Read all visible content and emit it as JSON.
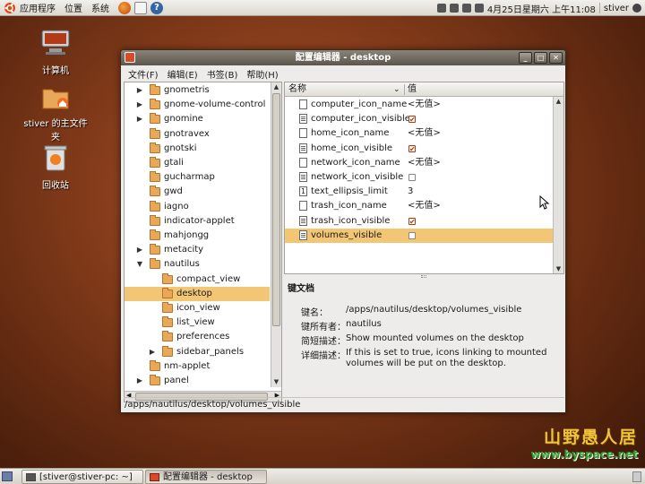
{
  "top_panel": {
    "menus": [
      "应用程序",
      "位置",
      "系统"
    ],
    "clock": "4月25日星期六 上午11:08",
    "user": "stiver"
  },
  "desktop": {
    "icons": [
      {
        "label": "计算机"
      },
      {
        "label": "stiver 的主文件夹"
      },
      {
        "label": "回收站"
      }
    ]
  },
  "window": {
    "title": "配置编辑器 - desktop",
    "menus": [
      "文件(F)",
      "编辑(E)",
      "书签(B)",
      "帮助(H)"
    ],
    "tree": [
      {
        "label": "gnometris",
        "expander": "▶",
        "level": 1
      },
      {
        "label": "gnome-volume-control",
        "expander": "▶",
        "level": 1
      },
      {
        "label": "gnomine",
        "expander": "▶",
        "level": 1
      },
      {
        "label": "gnotravex",
        "expander": "",
        "level": 1
      },
      {
        "label": "gnotski",
        "expander": "",
        "level": 1
      },
      {
        "label": "gtali",
        "expander": "",
        "level": 1
      },
      {
        "label": "gucharmap",
        "expander": "",
        "level": 1
      },
      {
        "label": "gwd",
        "expander": "",
        "level": 1
      },
      {
        "label": "iagno",
        "expander": "",
        "level": 1
      },
      {
        "label": "indicator-applet",
        "expander": "",
        "level": 1
      },
      {
        "label": "mahjongg",
        "expander": "",
        "level": 1
      },
      {
        "label": "metacity",
        "expander": "▶",
        "level": 1
      },
      {
        "label": "nautilus",
        "expander": "▼",
        "level": 1
      },
      {
        "label": "compact_view",
        "expander": "",
        "level": 2
      },
      {
        "label": "desktop",
        "expander": "",
        "level": 2,
        "selected": true
      },
      {
        "label": "icon_view",
        "expander": "",
        "level": 2
      },
      {
        "label": "list_view",
        "expander": "",
        "level": 2
      },
      {
        "label": "preferences",
        "expander": "",
        "level": 2
      },
      {
        "label": "sidebar_panels",
        "expander": "▶",
        "level": 2
      },
      {
        "label": "nm-applet",
        "expander": "",
        "level": 1
      },
      {
        "label": "panel",
        "expander": "▶",
        "level": 1
      }
    ],
    "keys_header": {
      "name": "名称",
      "value": "值"
    },
    "keys": [
      {
        "name": "computer_icon_name",
        "type": "string",
        "value": "<无值>"
      },
      {
        "name": "computer_icon_visible",
        "type": "bool",
        "checked": true
      },
      {
        "name": "home_icon_name",
        "type": "string",
        "value": "<无值>"
      },
      {
        "name": "home_icon_visible",
        "type": "bool",
        "checked": true
      },
      {
        "name": "network_icon_name",
        "type": "string",
        "value": "<无值>"
      },
      {
        "name": "network_icon_visible",
        "type": "bool",
        "checked": false
      },
      {
        "name": "text_ellipsis_limit",
        "type": "int",
        "value": "3"
      },
      {
        "name": "trash_icon_name",
        "type": "string",
        "value": "<无值>"
      },
      {
        "name": "trash_icon_visible",
        "type": "bool",
        "checked": true
      },
      {
        "name": "volumes_visible",
        "type": "bool",
        "checked": false,
        "selected": true
      }
    ],
    "doc": {
      "title": "键文档",
      "key_name_label": "键名：",
      "key_name": "/apps/nautilus/desktop/volumes_visible",
      "owner_label": "键所有者：",
      "owner": "nautilus",
      "short_label": "简短描述：",
      "short": "Show mounted volumes on the desktop",
      "long_label": "详细描述：",
      "long": "If this is set to true, icons linking to mounted volumes will be put on the desktop."
    },
    "status": "/apps/nautilus/desktop/volumes_visible"
  },
  "bottom_panel": {
    "tasks": [
      "[stiver@stiver-pc: ~]",
      "配置编辑器 - desktop"
    ]
  },
  "watermark": {
    "text": "山野愚人居",
    "url": "www.byspace.net"
  },
  "colors": {
    "selection": "#f2c675",
    "folder": "#e8a858",
    "check": "#c33a0a"
  }
}
